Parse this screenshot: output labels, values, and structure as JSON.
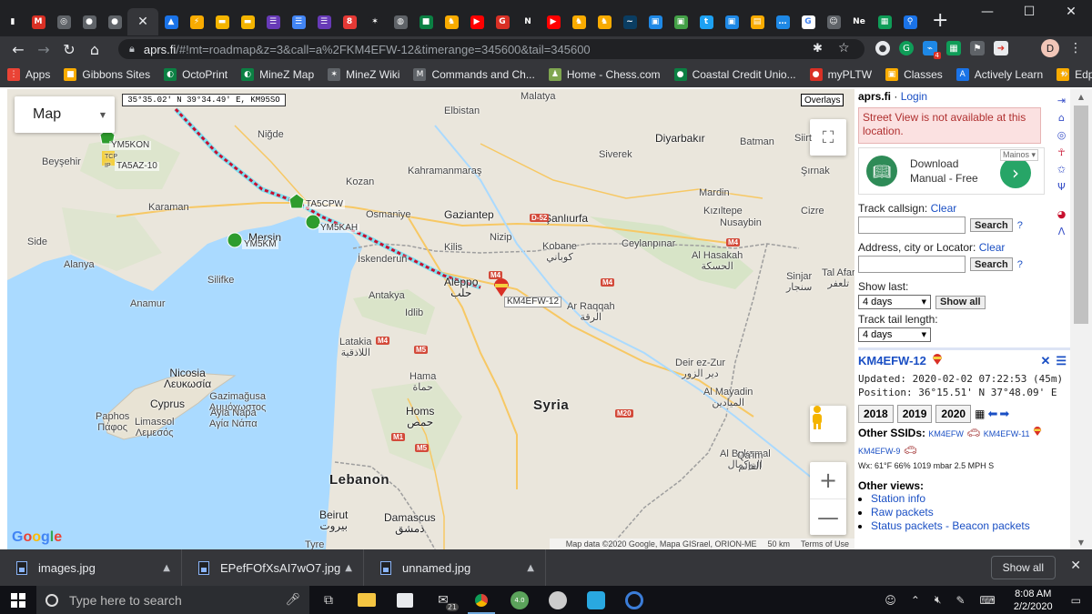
{
  "browser": {
    "active_tab_close": "✕",
    "new_tab": "+",
    "tab_favicons": [
      {
        "name": "signal-icon",
        "color": "#202124",
        "glyph": "▮"
      },
      {
        "name": "gmail-icon",
        "color": "#d93025",
        "glyph": "M"
      },
      {
        "name": "octo-icon",
        "color": "#5f6368",
        "glyph": "◎"
      },
      {
        "name": "grey-circle-icon",
        "color": "#5f6368",
        "glyph": "●"
      },
      {
        "name": "grey-circle-icon",
        "color": "#5f6368",
        "glyph": "●"
      },
      {
        "name": "contacts-icon",
        "color": "#1a73e8",
        "glyph": "▲"
      },
      {
        "name": "bolt-icon",
        "color": "#f9ab00",
        "glyph": "⚡"
      },
      {
        "name": "slides-icon",
        "color": "#f4b400",
        "glyph": "▬"
      },
      {
        "name": "slides-icon",
        "color": "#f4b400",
        "glyph": "▬"
      },
      {
        "name": "forms-icon",
        "color": "#673ab7",
        "glyph": "☰"
      },
      {
        "name": "docs-icon",
        "color": "#4285f4",
        "glyph": "☰"
      },
      {
        "name": "forms-icon",
        "color": "#673ab7",
        "glyph": "☰"
      },
      {
        "name": "app-icon",
        "color": "#e53935",
        "glyph": "8"
      },
      {
        "name": "star-red-icon",
        "color": "#202124",
        "glyph": "✶"
      },
      {
        "name": "globe-icon",
        "color": "#5f6368",
        "glyph": "◍"
      },
      {
        "name": "colorful-icon",
        "color": "#0b8043",
        "glyph": "■"
      },
      {
        "name": "chess-icon",
        "color": "#f9ab00",
        "glyph": "♞"
      },
      {
        "name": "youtube-icon",
        "color": "#ff0000",
        "glyph": "▶"
      },
      {
        "name": "g-red-icon",
        "color": "#d93025",
        "glyph": "G"
      },
      {
        "name": "netflix-icon",
        "color": "#202124",
        "glyph": "N"
      },
      {
        "name": "youtube-icon",
        "color": "#ff0000",
        "glyph": "▶"
      },
      {
        "name": "chess-icon",
        "color": "#f9ab00",
        "glyph": "♞"
      },
      {
        "name": "chess-icon",
        "color": "#f9ab00",
        "glyph": "♞"
      },
      {
        "name": "wave-icon",
        "color": "#0a3d62",
        "glyph": "~"
      },
      {
        "name": "square-icon",
        "color": "#1e88e5",
        "glyph": "▣"
      },
      {
        "name": "square-icon",
        "color": "#43a047",
        "glyph": "▣"
      },
      {
        "name": "twitter-icon",
        "color": "#1da1f2",
        "glyph": "t"
      },
      {
        "name": "square-icon",
        "color": "#1e88e5",
        "glyph": "▣"
      },
      {
        "name": "image-icon",
        "color": "#f9ab00",
        "glyph": "▤"
      },
      {
        "name": "chat-icon",
        "color": "#1e88e5",
        "glyph": "…"
      },
      {
        "name": "google-icon",
        "color": "#ffffff",
        "glyph": "G"
      },
      {
        "name": "face-icon",
        "color": "#5f6368",
        "glyph": "☺"
      },
      {
        "name": "ne-icon",
        "color": "#202124",
        "glyph": "Ne"
      },
      {
        "name": "sheet-icon",
        "color": "#0f9d58",
        "glyph": "▦"
      },
      {
        "name": "search-blue-icon",
        "color": "#1a73e8",
        "glyph": "⚲"
      }
    ],
    "window": {
      "minimize": "—",
      "maximize": "☐",
      "close": "✕"
    },
    "url_host": "aprs.fi",
    "url_path": "/#!mt=roadmap&z=3&call=a%2FKM4EFW-12&timerange=345600&tail=345600",
    "avatar_letter": "D",
    "bookmarks": [
      {
        "label": "Apps",
        "color": "#ea4335",
        "glyph": "⋮"
      },
      {
        "label": "Gibbons Sites",
        "color": "#f9ab00",
        "glyph": "■"
      },
      {
        "label": "OctoPrint",
        "color": "#0b8043",
        "glyph": "◐"
      },
      {
        "label": "MineZ Map",
        "color": "#0b8043",
        "glyph": "◐"
      },
      {
        "label": "MineZ Wiki",
        "color": "#5f6368",
        "glyph": "✶"
      },
      {
        "label": "Commands and Ch...",
        "color": "#5f6368",
        "glyph": "M"
      },
      {
        "label": "Home - Chess.com",
        "color": "#7fa650",
        "glyph": "♟"
      },
      {
        "label": "Coastal Credit Unio...",
        "color": "#0b8043",
        "glyph": "●"
      },
      {
        "label": "myPLTW",
        "color": "#d93025",
        "glyph": "●"
      },
      {
        "label": "Classes",
        "color": "#f9ab00",
        "glyph": "▣"
      },
      {
        "label": "Actively Learn",
        "color": "#1a73e8",
        "glyph": "A"
      },
      {
        "label": "Edpuzzle",
        "color": "#f9ab00",
        "glyph": "✦"
      }
    ],
    "bookmarks_more": "»"
  },
  "map": {
    "type_label": "Map",
    "coord_readout": "35°35.02' N 39°34.49' E, KM95SO",
    "overlays_label": "Overlays",
    "zoom_in": "+",
    "zoom_out": "—",
    "google_logo": "Google",
    "attribution": {
      "data": "Map data ©2020 Google, Mapa GISrael, ORION-ME",
      "scale": "50 km",
      "terms": "Terms of Use"
    },
    "places": [
      {
        "id": "malatya",
        "text": "Malatya"
      },
      {
        "id": "elbistan",
        "text": "Elbistan"
      },
      {
        "id": "nigde",
        "text": "Niğde"
      },
      {
        "id": "diyarbakir",
        "text": "Diyarbakır"
      },
      {
        "id": "batman",
        "text": "Batman"
      },
      {
        "id": "siirt",
        "text": "Siirt"
      },
      {
        "id": "kahramanmaras",
        "text": "Kahramanmaraş"
      },
      {
        "id": "siverek",
        "text": "Siverek"
      },
      {
        "id": "sirnak",
        "text": "Şırnak"
      },
      {
        "id": "beysehir",
        "text": "Beyşehir"
      },
      {
        "id": "kozan",
        "text": "Kozan"
      },
      {
        "id": "karaman",
        "text": "Karaman"
      },
      {
        "id": "osmaniye",
        "text": "Osmaniye"
      },
      {
        "id": "gaziantep",
        "text": "Gaziantep"
      },
      {
        "id": "sanliurfa",
        "text": "Şanlıurfa"
      },
      {
        "id": "mardin",
        "text": "Mardin"
      },
      {
        "id": "cizre",
        "text": "Cizre"
      },
      {
        "id": "nusaybin",
        "text": "Nusaybin"
      },
      {
        "id": "kiziltepe",
        "text": "Kızıltepe"
      },
      {
        "id": "mersin",
        "text": "Mersin"
      },
      {
        "id": "side",
        "text": "Side"
      },
      {
        "id": "kilis",
        "text": "Kilis"
      },
      {
        "id": "nizip",
        "text": "Nizip"
      },
      {
        "id": "kobane",
        "text": "Kobane\nكوباني"
      },
      {
        "id": "ceylanpinar",
        "text": "Ceylanpınar"
      },
      {
        "id": "alanya",
        "text": "Alanya"
      },
      {
        "id": "silifke",
        "text": "Silifke"
      },
      {
        "id": "iskenderun",
        "text": "İskenderun"
      },
      {
        "id": "alhasakah",
        "text": "Al Hasakah\nالحسكة"
      },
      {
        "id": "sinjar",
        "text": "Sinjar\nسنجار"
      },
      {
        "id": "talafar",
        "text": "Tal Afar\nتلعفر"
      },
      {
        "id": "aleppo",
        "text": "Aleppo\nحلب"
      },
      {
        "id": "anamur",
        "text": "Anamur"
      },
      {
        "id": "antakya",
        "text": "Antakya"
      },
      {
        "id": "idlib",
        "text": "Idlib"
      },
      {
        "id": "arraqqah",
        "text": "Ar Raqqah\nالرقة"
      },
      {
        "id": "latakia",
        "text": "Latakia\nاللاذقية"
      },
      {
        "id": "deirezzur",
        "text": "Deir ez-Zur\nدير الزور"
      },
      {
        "id": "almayadin",
        "text": "Al Mayadin\nالميادين"
      },
      {
        "id": "nicosia",
        "text": "Nicosia\nΛευκωσία"
      },
      {
        "id": "hama",
        "text": "Hama\nحماة"
      },
      {
        "id": "cyprus",
        "text": "Cyprus"
      },
      {
        "id": "gazimagusa",
        "text": "Gazimağusa\nΑμμόχωστος"
      },
      {
        "id": "paphos",
        "text": "Paphos\nΠάφος"
      },
      {
        "id": "limassol",
        "text": "Limassol\nΛεμεσός"
      },
      {
        "id": "ayianapa",
        "text": "Ayia Napa\nΑγία Νάπα"
      },
      {
        "id": "homs",
        "text": "Homs\nحمص"
      },
      {
        "id": "syria",
        "text": "Syria"
      },
      {
        "id": "albukamal",
        "text": "Al Bukamal\nالبوكمال"
      },
      {
        "id": "qaim",
        "text": "Qa'im\nالقائم"
      },
      {
        "id": "lebanon",
        "text": "Lebanon"
      },
      {
        "id": "beirut",
        "text": "Beirut\nبيروت"
      },
      {
        "id": "damascus",
        "text": "Damascus\nدمشق"
      },
      {
        "id": "tyre",
        "text": "Tyre"
      }
    ],
    "shields": [
      {
        "id": "d52",
        "text": "D-52"
      },
      {
        "id": "m4a",
        "text": "M4"
      },
      {
        "id": "m4b",
        "text": "M4"
      },
      {
        "id": "m4c",
        "text": "M4"
      },
      {
        "id": "m4d",
        "text": "M4"
      },
      {
        "id": "m5a",
        "text": "M5"
      },
      {
        "id": "m5b",
        "text": "M5"
      },
      {
        "id": "m1",
        "text": "M1"
      },
      {
        "id": "m20",
        "text": "M20"
      }
    ],
    "stations": [
      {
        "id": "ym5kon",
        "text": "YM5KON"
      },
      {
        "id": "ta5az",
        "text": "TA5AZ-10"
      },
      {
        "id": "tcpip",
        "text": "TCP\nIP"
      },
      {
        "id": "ta5cpw",
        "text": "TA5CPW"
      },
      {
        "id": "ym5kah",
        "text": "YM5KAH"
      },
      {
        "id": "ym5km",
        "text": "YM5KM"
      },
      {
        "id": "km4efw12",
        "text": "KM4EFW-12"
      }
    ],
    "colors": {
      "land": "#eae6dc",
      "sea": "#aadaff",
      "green": "#cfe3bd",
      "track": "#c8102e",
      "track_alt": "#7fe0f0",
      "road": "#f7c864"
    }
  },
  "panel": {
    "site": "aprs.fi",
    "sep": "·",
    "login": "Login",
    "street_view_msg": "Street View is not available at this location.",
    "ad": {
      "tag": "Mainos ▾",
      "line1": "Download",
      "line2": "Manual - Free",
      "arrow": "›"
    },
    "track_callsign_label": "Track callsign:",
    "address_label": "Address, city or Locator:",
    "clear": "Clear",
    "search": "Search",
    "help": "?",
    "show_last_label": "Show last:",
    "show_last_value": "4 days",
    "show_all": "Show all",
    "tail_label": "Track tail length:",
    "tail_value": "4 days",
    "station": "KM4EFW-12",
    "close_icon": "✕",
    "menu_icon": "☰",
    "updated": "Updated: 2020-02-02 07:22:53 (45m)",
    "position": "Position: 36°15.51' N 37°48.09' E",
    "years": [
      "2018",
      "2019",
      "2020"
    ],
    "other_ssids_label": "Other SSIDs:",
    "ssids": [
      "KM4EFW",
      "KM4EFW-11",
      "KM4EFW-9"
    ],
    "wx": "Wx: 61°F 66% 1019 mbar 2.5 MPH S",
    "other_views_label": "Other views:",
    "views": [
      "Station info",
      "Raw packets",
      "Status packets - Beacon packets"
    ]
  },
  "downloads": {
    "items": [
      "images.jpg",
      "EPefFOfXsAI7wO7.jpg",
      "unnamed.jpg"
    ],
    "show_all": "Show all",
    "close": "✕"
  },
  "taskbar": {
    "search_placeholder": "Type here to search",
    "clock_time": "8:08 AM",
    "clock_date": "2/2/2020",
    "badge": "21",
    "badge2": "4.0",
    "notif": "4"
  }
}
